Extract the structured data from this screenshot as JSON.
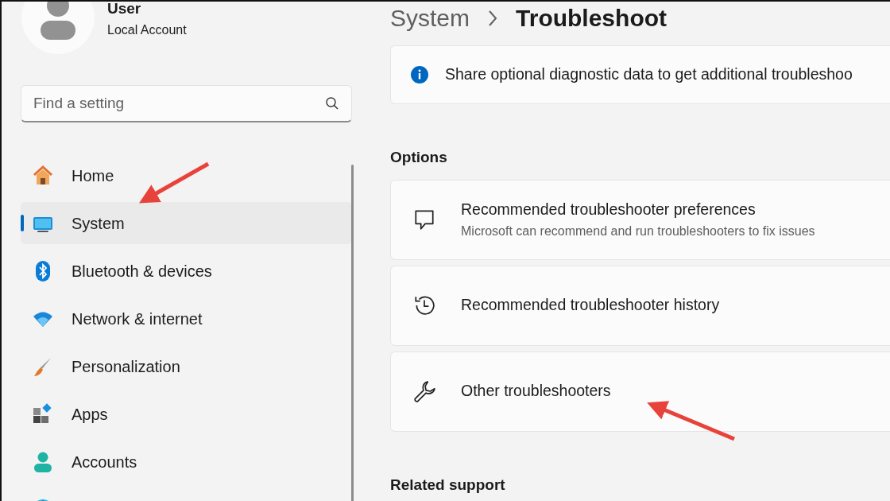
{
  "account": {
    "name": "User",
    "type": "Local Account"
  },
  "search": {
    "placeholder": "Find a setting"
  },
  "nav": [
    {
      "kind": "home",
      "label": "Home",
      "selected": false
    },
    {
      "kind": "system",
      "label": "System",
      "selected": true
    },
    {
      "kind": "bluetooth",
      "label": "Bluetooth & devices",
      "selected": false
    },
    {
      "kind": "network",
      "label": "Network & internet",
      "selected": false
    },
    {
      "kind": "personalization",
      "label": "Personalization",
      "selected": false
    },
    {
      "kind": "apps",
      "label": "Apps",
      "selected": false
    },
    {
      "kind": "accounts",
      "label": "Accounts",
      "selected": false
    },
    {
      "kind": "time"
    }
  ],
  "breadcrumb": [
    "System",
    "Troubleshoot"
  ],
  "info_banner": "Share optional diagnostic data to get additional troubleshoo",
  "options_heading": "Options",
  "options": [
    {
      "kind": "chat",
      "title": "Recommended troubleshooter preferences",
      "subtitle": "Microsoft can recommend and run troubleshooters to fix issues"
    },
    {
      "kind": "history",
      "title": "Recommended troubleshooter history"
    },
    {
      "kind": "wrench",
      "title": "Other troubleshooters"
    }
  ],
  "related_heading": "Related support"
}
